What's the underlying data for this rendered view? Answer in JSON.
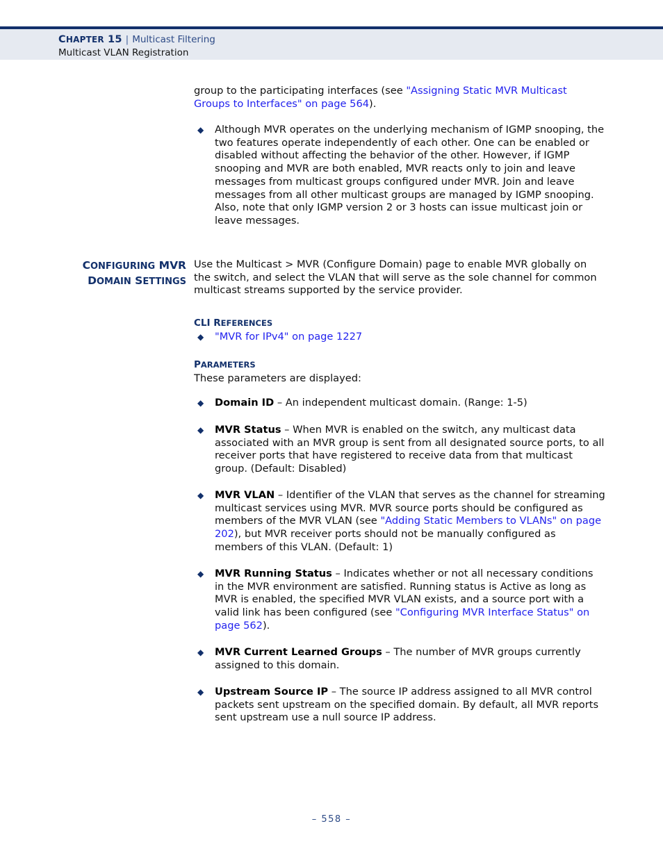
{
  "header": {
    "chapter_prefix": "C",
    "chapter_rest": "HAPTER",
    "chapter_number": "15",
    "separator": "|",
    "topic": "Multicast Filtering",
    "subtitle": "Multicast VLAN Registration"
  },
  "intro": {
    "continued_text_before": "group to the participating interfaces (see ",
    "continued_link": "\"Assigning Static MVR Multicast Groups to Interfaces\" on page 564",
    "continued_text_after": ").",
    "bullet_igmp": "Although MVR operates on the underlying mechanism of IGMP snooping, the two features operate independently of each other. One can be enabled or disabled without affecting the behavior of the other. However, if IGMP snooping and MVR are both enabled, MVR reacts only to join and leave messages from multicast groups configured under MVR. Join and leave messages from all other multicast groups are managed by IGMP snooping. Also, note that only IGMP version 2 or 3 hosts can issue multicast join or leave messages."
  },
  "section": {
    "side_heading_line1_cap": "C",
    "side_heading_line1_sc": "ONFIGURING",
    "side_heading_line1_tail": "MVR",
    "side_heading_line2_cap": "D",
    "side_heading_line2_sc": "OMAIN",
    "side_heading_line2_cap2": "S",
    "side_heading_line2_sc2": "ETTINGS",
    "intro_paragraph": "Use the Multicast > MVR (Configure Domain) page to enable MVR globally on the switch, and select the VLAN that will serve as the sole channel for common multicast streams supported by the service provider."
  },
  "cli_references": {
    "heading_cap": "CLI R",
    "heading_sc": "EFERENCES",
    "items": [
      "\"MVR for IPv4\" on page 1227"
    ]
  },
  "parameters": {
    "heading_cap": "P",
    "heading_sc": "ARAMETERS",
    "intro": "These parameters are displayed:",
    "items": [
      {
        "term": "Domain ID",
        "dash": " – ",
        "desc": "An independent multicast domain. (Range: 1-5)"
      },
      {
        "term": "MVR Status",
        "dash": " – ",
        "desc": "When MVR is enabled on the switch, any multicast data associated with an MVR group is sent from all designated source ports, to all receiver ports that have registered to receive data from that multicast group. (Default: Disabled)"
      },
      {
        "term": "MVR VLAN",
        "dash": " – ",
        "desc_part1": "Identifier of the VLAN that serves as the channel for streaming multicast services using MVR. MVR source ports should be configured as members of the MVR VLAN (see ",
        "link": "\"Adding Static Members to VLANs\" on page 202",
        "desc_part2": "), but MVR receiver ports should not be manually configured as members of this VLAN. (Default: 1)"
      },
      {
        "term": "MVR Running Status",
        "dash": " – ",
        "desc_part1": "Indicates whether or not all necessary conditions in the MVR environment are satisfied. Running status is Active as long as MVR is enabled, the specified MVR VLAN exists, and a source port with a valid link has been configured (see ",
        "link": "\"Configuring MVR Interface Status\" on page 562",
        "desc_part2": ")."
      },
      {
        "term": "MVR Current Learned Groups",
        "dash": " – ",
        "desc": "The number of MVR groups currently assigned to this domain."
      },
      {
        "term": "Upstream Source IP",
        "dash": " – ",
        "desc": "The source IP address assigned to all MVR control packets sent upstream on the specified domain. By default, all MVR reports sent upstream use a null source IP address."
      }
    ]
  },
  "footer": {
    "page_marker": "–  558  –"
  },
  "glyphs": {
    "bullet_diamond": "◆"
  },
  "colors": {
    "navy": "#12306b",
    "link_blue": "#2222ee",
    "header_band": "#e6eaf1",
    "header_topic": "#2c4a86"
  }
}
